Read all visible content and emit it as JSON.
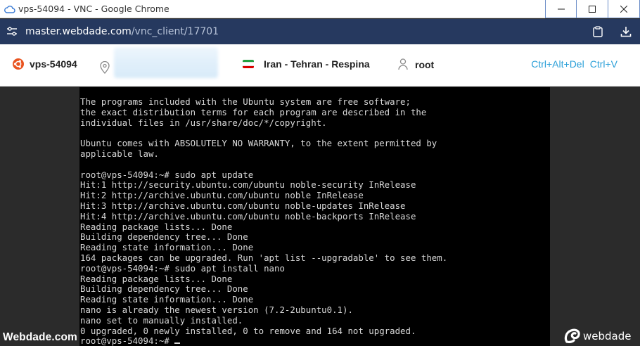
{
  "window": {
    "title": "vps-54094 - VNC - Google Chrome",
    "minimize_glyph": "—",
    "maximize_glyph": "☐",
    "close_glyph": "✕"
  },
  "address": {
    "host": "master.webdade.com",
    "path": "/vnc_client/17701"
  },
  "toolbar": {
    "hostname": "vps-54094",
    "location": "Iran - Tehran - Respina",
    "user": "root",
    "ctrl_alt_del": "Ctrl+Alt+Del",
    "ctrl_v": "Ctrl+V"
  },
  "terminal": {
    "lines": [
      "The programs included with the Ubuntu system are free software;",
      "the exact distribution terms for each program are described in the",
      "individual files in /usr/share/doc/*/copyright.",
      "",
      "Ubuntu comes with ABSOLUTELY NO WARRANTY, to the extent permitted by",
      "applicable law.",
      "",
      "root@vps-54094:~# sudo apt update",
      "Hit:1 http://security.ubuntu.com/ubuntu noble-security InRelease",
      "Hit:2 http://archive.ubuntu.com/ubuntu noble InRelease",
      "Hit:3 http://archive.ubuntu.com/ubuntu noble-updates InRelease",
      "Hit:4 http://archive.ubuntu.com/ubuntu noble-backports InRelease",
      "Reading package lists... Done",
      "Building dependency tree... Done",
      "Reading state information... Done",
      "164 packages can be upgraded. Run 'apt list --upgradable' to see them.",
      "root@vps-54094:~# sudo apt install nano",
      "Reading package lists... Done",
      "Building dependency tree... Done",
      "Reading state information... Done",
      "nano is already the newest version (7.2-2ubuntu0.1).",
      "nano set to manually installed.",
      "0 upgraded, 0 newly installed, 0 to remove and 164 not upgraded."
    ],
    "prompt": "root@vps-54094:~# "
  },
  "watermark": {
    "left": "Webdade.com",
    "right": "webdade"
  },
  "colors": {
    "address_bar": "#26395f",
    "terminal_bg": "#000000",
    "terminal_fg": "#d8d8d8",
    "accent": "#2a9fd8",
    "ubuntu_orange": "#e95420"
  }
}
